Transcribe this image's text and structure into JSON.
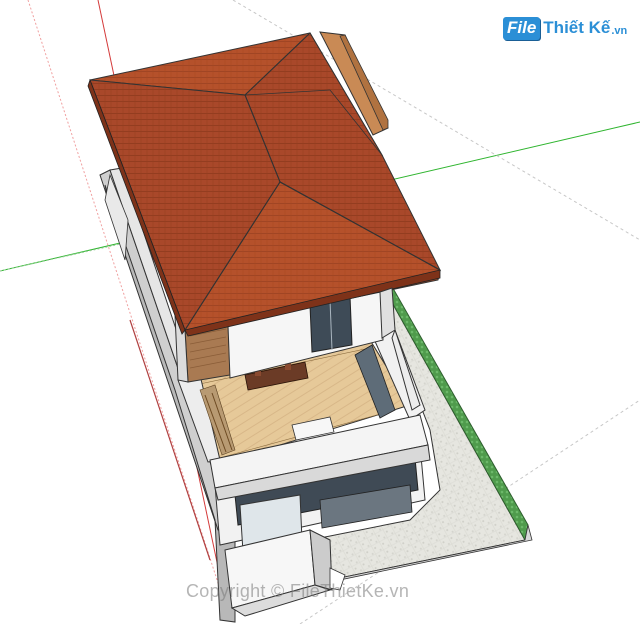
{
  "logo": {
    "badge": "File",
    "name": "Thiết Kế",
    "suffix": ".vn"
  },
  "watermark": {
    "text": "Copyright © FileThietKe.vn"
  },
  "colors": {
    "roof": "#b4502a",
    "roof_dark": "#9a4122",
    "wall": "#f2f2f2",
    "wall_shade": "#c9c9c9",
    "floor_wood": "#e3c596",
    "tiles": "#e4e4de",
    "grass": "#5aa35a",
    "axis_green": "#2fb52f",
    "axis_red": "#d43a3a"
  },
  "model": {
    "subject": "two-storey-house",
    "icons": [
      "house-model-icon"
    ]
  }
}
